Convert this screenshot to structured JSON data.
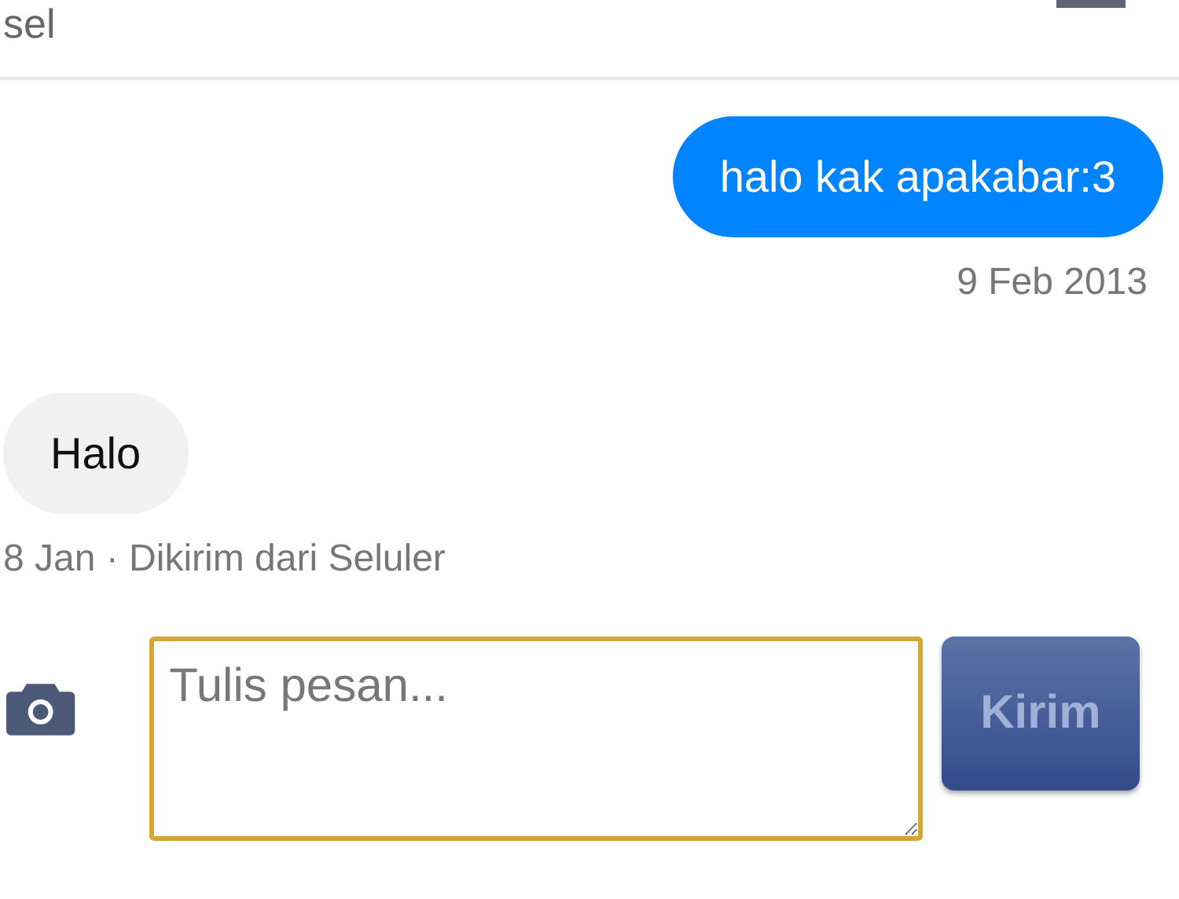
{
  "header": {
    "title": "sel"
  },
  "messages": [
    {
      "kind": "sent",
      "text": "halo kak apakabar:3",
      "meta": "9 Feb 2013"
    },
    {
      "kind": "received",
      "text": "Halo",
      "meta": "8 Jan · Dikirim dari Seluler"
    }
  ],
  "composer": {
    "placeholder": "Tulis pesan...",
    "send": {
      "label": "Kirim",
      "disabled": true
    }
  }
}
